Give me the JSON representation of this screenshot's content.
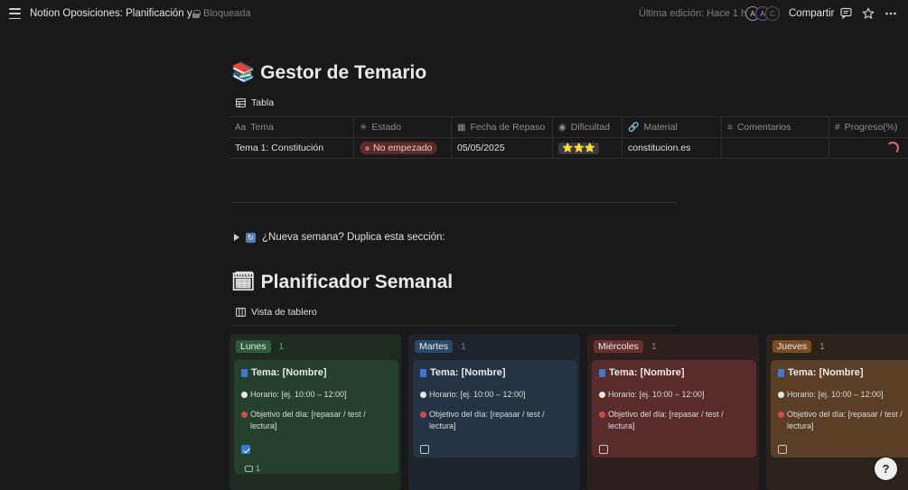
{
  "topbar": {
    "title": "Notion Oposiciones: Planificación y...",
    "locked_label": "Bloqueada",
    "last_edit": "Última edición: Hace 1 h",
    "avatars": [
      "A",
      "A",
      "C"
    ],
    "share_label": "Compartir"
  },
  "temario": {
    "emoji": "📚",
    "title": "Gestor de Temario",
    "view_label": "Tabla",
    "columns": [
      {
        "icon": "Aa",
        "label": "Tema"
      },
      {
        "icon": "✳",
        "label": "Estado"
      },
      {
        "icon": "▦",
        "label": "Fecha de Repaso"
      },
      {
        "icon": "◉",
        "label": "Dificultad"
      },
      {
        "icon": "🔗",
        "label": "Material"
      },
      {
        "icon": "≡",
        "label": "Comentarios"
      },
      {
        "icon": "#",
        "label": "Progreso(%)"
      }
    ],
    "rows": [
      {
        "tema": "Tema 1: Constitución",
        "estado": "No empezado",
        "fecha": "05/05/2025",
        "dificultad": "⭐⭐⭐",
        "material": "constitucion.es",
        "comentarios": ""
      }
    ]
  },
  "toggle": {
    "label": "¿Nueva semana? Duplica esta sección:"
  },
  "planner": {
    "emoji": "🗓",
    "title": "Planificador Semanal",
    "view_label": "Vista de tablero",
    "columns": [
      {
        "name": "Lunes",
        "count": "1",
        "checked": true,
        "comments": "1",
        "bg": "#1f2a21",
        "tag_bg": "#2f5c3a",
        "card_bg": "#25402c",
        "count_color": "#5f9a6c"
      },
      {
        "name": "Martes",
        "count": "1",
        "checked": false,
        "comments": "",
        "bg": "#1d242c",
        "tag_bg": "#2c4a68",
        "card_bg": "#243445",
        "count_color": "#5f86b0"
      },
      {
        "name": "Miércoles",
        "count": "1",
        "checked": false,
        "comments": "",
        "bg": "#2e1f1f",
        "tag_bg": "#6a2f2f",
        "card_bg": "#5a2b2b",
        "count_color": "#c66a6a"
      },
      {
        "name": "Jueves",
        "count": "1",
        "checked": false,
        "comments": "",
        "bg": "#2c241c",
        "tag_bg": "#7a4d22",
        "card_bg": "#5a3f26",
        "count_color": "#c48a4c"
      }
    ],
    "card": {
      "title": "Tema: [Nombre]",
      "horario": "Horario: [ej. 10:00 – 12:00]",
      "objetivo": "Objetivo del día: [repasar / test / lectura]"
    }
  }
}
